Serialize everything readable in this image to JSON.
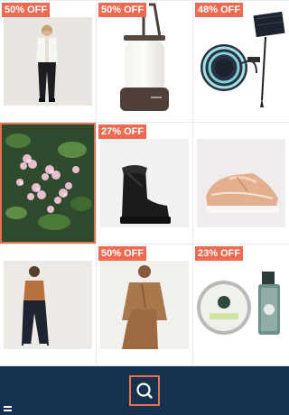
{
  "products": [
    {
      "badge": "50% OFF",
      "image": "woman-white-blazer-black-trousers"
    },
    {
      "badge": "50% OFF",
      "image": "portable-lantern-lamp"
    },
    {
      "badge": "48% OFF",
      "image": "solar-led-strip-light"
    },
    {
      "badge": "",
      "image": "pink-flowering-plant",
      "selected": true
    },
    {
      "badge": "27% OFF",
      "image": "black-ankle-boot"
    },
    {
      "badge": "",
      "image": "rose-gold-sneaker"
    },
    {
      "badge": "",
      "image": "woman-tan-blouse-navy-trousers"
    },
    {
      "badge": "50% OFF",
      "image": "woman-camel-jacket-set"
    },
    {
      "badge": "23% OFF",
      "image": "shaving-balm-and-cologne"
    }
  ],
  "bottom_bar": {
    "search_icon": "search-icon",
    "menu_icon": "menu-icon"
  },
  "colors": {
    "badge": "#ee6b52",
    "bottom_bar": "#16324f",
    "accent": "#e8704f"
  }
}
